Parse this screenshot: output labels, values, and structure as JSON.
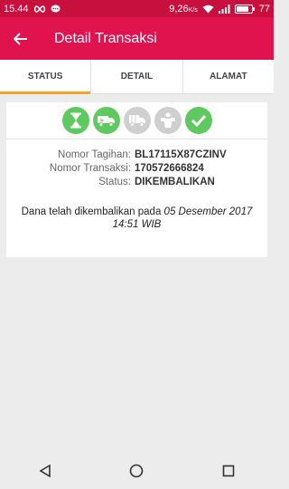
{
  "status_bar": {
    "time": "15.44",
    "speed": "9,26",
    "speed_unit": "K/s",
    "battery": "77"
  },
  "app_bar": {
    "title": "Detail Transaksi"
  },
  "tabs": [
    {
      "label": "STATUS",
      "active": true
    },
    {
      "label": "DETAIL",
      "active": false
    },
    {
      "label": "ALAMAT",
      "active": false
    }
  ],
  "progress": {
    "completed_steps": 2,
    "total_steps": 5,
    "colors": {
      "done": "#5ec95e",
      "todo": "#cfcfcf"
    },
    "icons": [
      "hourglass-icon",
      "truck-icon",
      "delivery-truck-icon",
      "package-person-icon",
      "check-icon"
    ]
  },
  "details": {
    "nomor_tagihan_label": "Nomor Tagihan:",
    "nomor_tagihan_value": "BL17115X87CZINV",
    "nomor_transaksi_label": "Nomor Transaksi:",
    "nomor_transaksi_value": "170572666824",
    "status_label": "Status:",
    "status_value": "DIKEMBALIKAN"
  },
  "refund_note": {
    "prefix": "Dana telah dikembalikan pada ",
    "date": "05 Desember 2017",
    "time": "14:51 WIB"
  },
  "colors": {
    "appbar": "#e0134f",
    "statusbar": "#c8103f",
    "tab_indicator": "#f5a623"
  }
}
